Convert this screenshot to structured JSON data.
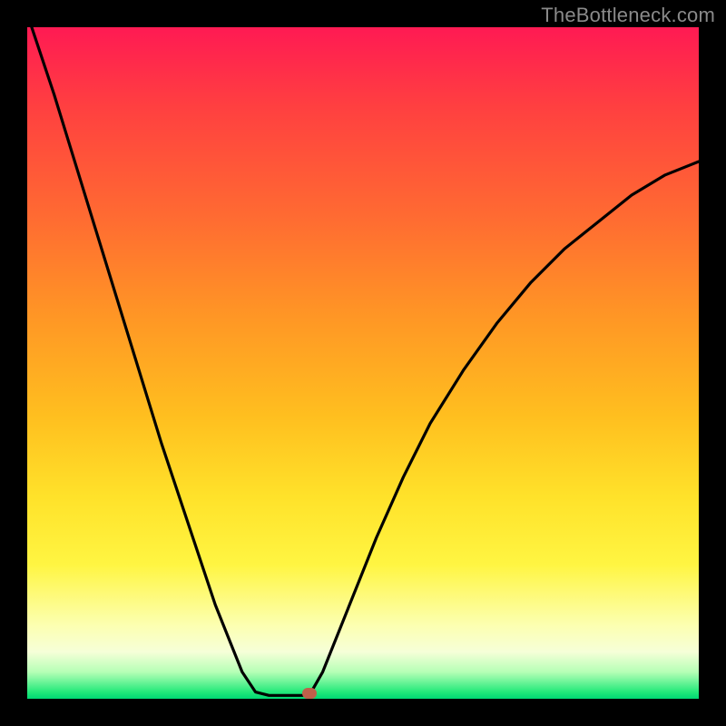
{
  "watermark": "TheBottleneck.com",
  "chart_data": {
    "type": "line",
    "title": "",
    "xlabel": "",
    "ylabel": "",
    "xlim": [
      0,
      100
    ],
    "ylim": [
      0,
      100
    ],
    "series": [
      {
        "name": "curve-left",
        "x": [
          0,
          4,
          8,
          12,
          16,
          20,
          24,
          28,
          32,
          34,
          36
        ],
        "y": [
          102,
          90,
          77,
          64,
          51,
          38,
          26,
          14,
          4,
          1,
          0.5
        ]
      },
      {
        "name": "curve-bottom",
        "x": [
          36,
          37.5,
          39,
          40.5,
          42
        ],
        "y": [
          0.5,
          0.5,
          0.5,
          0.5,
          0.5
        ]
      },
      {
        "name": "curve-right",
        "x": [
          42,
          44,
          48,
          52,
          56,
          60,
          65,
          70,
          75,
          80,
          85,
          90,
          95,
          100
        ],
        "y": [
          0.5,
          4,
          14,
          24,
          33,
          41,
          49,
          56,
          62,
          67,
          71,
          75,
          78,
          80
        ]
      }
    ],
    "marker": {
      "x": 42,
      "y": 0.8
    }
  },
  "colors": {
    "background": "#000000",
    "curve": "#000000",
    "marker": "#c0604a"
  }
}
